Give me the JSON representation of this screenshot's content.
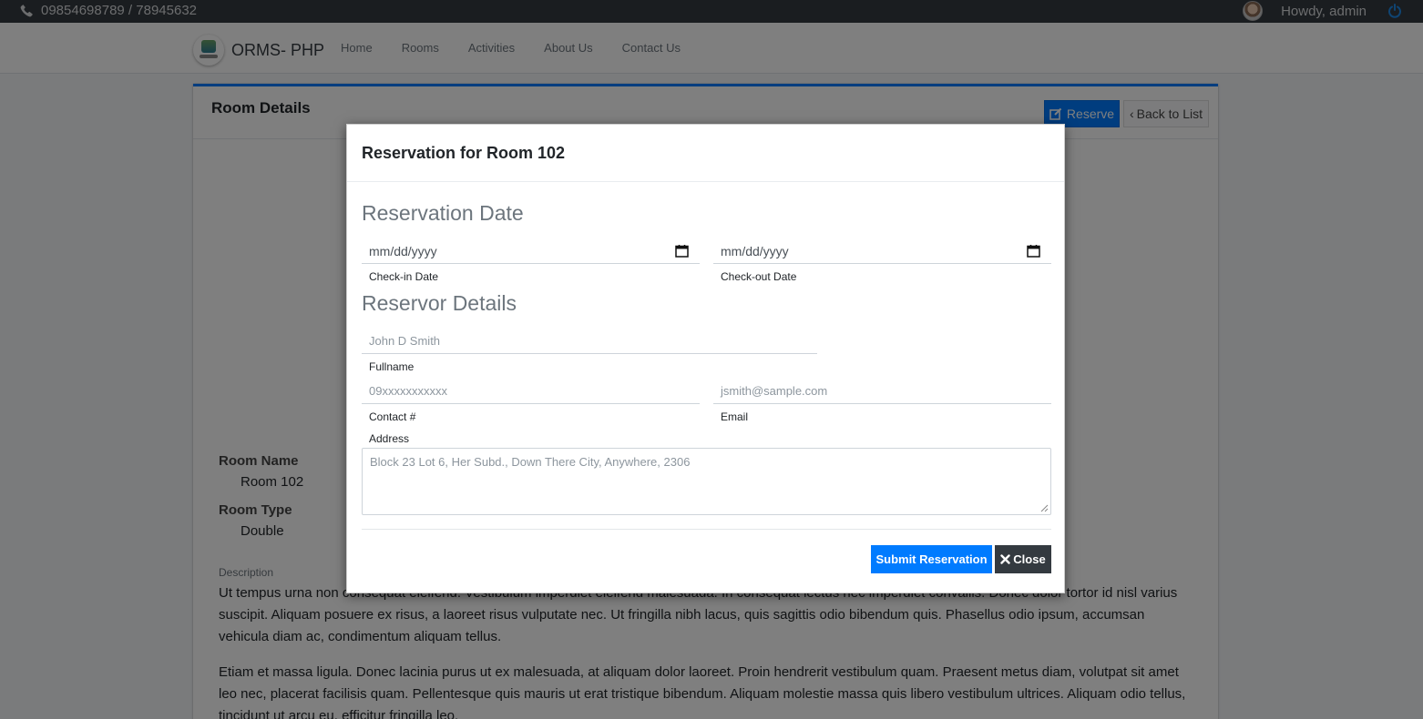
{
  "topbar": {
    "phone": "09854698789 / 78945632",
    "greeting": "Howdy, admin"
  },
  "navbar": {
    "brand": "ORMS- PHP",
    "links": [
      "Home",
      "Rooms",
      "Activities",
      "About Us",
      "Contact Us"
    ]
  },
  "card": {
    "title": "Room Details",
    "reserve_label": "Reserve",
    "back_label": "Back to List",
    "room_name_label": "Room Name",
    "room_name": "Room 102",
    "room_type_label": "Room Type",
    "room_type": "Double",
    "description_label": "Description",
    "description": [
      "Ut tempus urna non consequat eleifend. Vestibulum imperdiet eleifend malesuada. In consequat lectus nec imperdiet convallis. Donec dolor tortor id nisl varius suscipit. Aliquam posuere ex risus, a laoreet risus vulputate nec. Ut fringilla nibh lacus, quis sagittis odio bibendum quis. Phasellus odio ipsum, accumsan vehicula diam ac, condimentum aliquam tellus.",
      "Etiam et massa ligula. Donec lacinia purus ut ex malesuada, at aliquam dolor laoreet. Proin hendrerit vestibulum quam. Praesent metus diam, volutpat sit amet leo nec, placerat facilisis quam. Pellentesque quis mauris ut erat tristique bibendum. Aliquam molestie massa quis libero vestibulum ultrices. Aliquam odio tellus, tincidunt ut arcu eu, efficitur fringilla leo."
    ]
  },
  "modal": {
    "title": "Reservation for Room 102",
    "date_section": "Reservation Date",
    "checkin_placeholder": "mm/dd/yyyy",
    "checkin_label": "Check-in Date",
    "checkout_placeholder": "mm/dd/yyyy",
    "checkout_label": "Check-out Date",
    "reservor_section": "Reservor Details",
    "fullname_placeholder": "John D Smith",
    "fullname_label": "Fullname",
    "contact_placeholder": "09xxxxxxxxxxx",
    "contact_label": "Contact #",
    "email_placeholder": "jsmith@sample.com",
    "email_label": "Email",
    "address_label": "Address",
    "address_placeholder": "Block 23 Lot 6, Her Subd., Down There City, Anywhere, 2306",
    "submit_label": "Submit Reservation",
    "close_label": "Close"
  },
  "colors": {
    "primary": "#007bff",
    "dark": "#343a40",
    "overlay": "rgba(0,0,0,0.5)"
  }
}
